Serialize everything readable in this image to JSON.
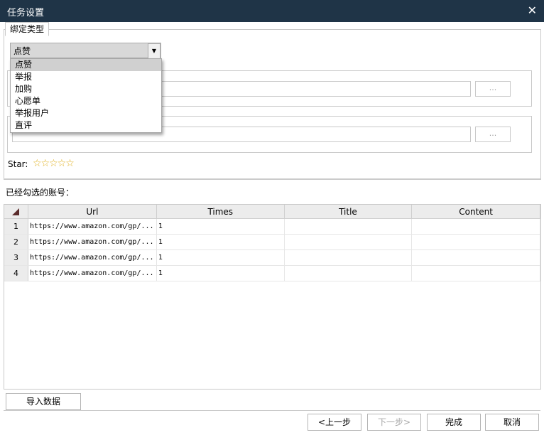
{
  "window": {
    "title": "任务设置"
  },
  "tab": {
    "label": "绑定类型"
  },
  "combo": {
    "selected": "点赞",
    "options": [
      "点赞",
      "举报",
      "加购",
      "心愿单",
      "举报用户",
      "直评"
    ]
  },
  "browse_label": "...",
  "star": {
    "label": "Star:",
    "stars": "☆☆☆☆☆"
  },
  "selected_accounts_label": "已经勾选的账号：",
  "table": {
    "columns": [
      "Url",
      "Times",
      "Title",
      "Content"
    ],
    "rows": [
      {
        "num": "1",
        "url": "https://www.amazon.com/gp/...",
        "times": "1",
        "title": "",
        "content": ""
      },
      {
        "num": "2",
        "url": "https://www.amazon.com/gp/...",
        "times": "1",
        "title": "",
        "content": ""
      },
      {
        "num": "3",
        "url": "https://www.amazon.com/gp/...",
        "times": "1",
        "title": "",
        "content": ""
      },
      {
        "num": "4",
        "url": "https://www.amazon.com/gp/...",
        "times": "1",
        "title": "",
        "content": ""
      }
    ]
  },
  "buttons": {
    "import": "导入数据",
    "prev": "<上一步",
    "next": "下一步>",
    "finish": "完成",
    "cancel": "取消"
  }
}
